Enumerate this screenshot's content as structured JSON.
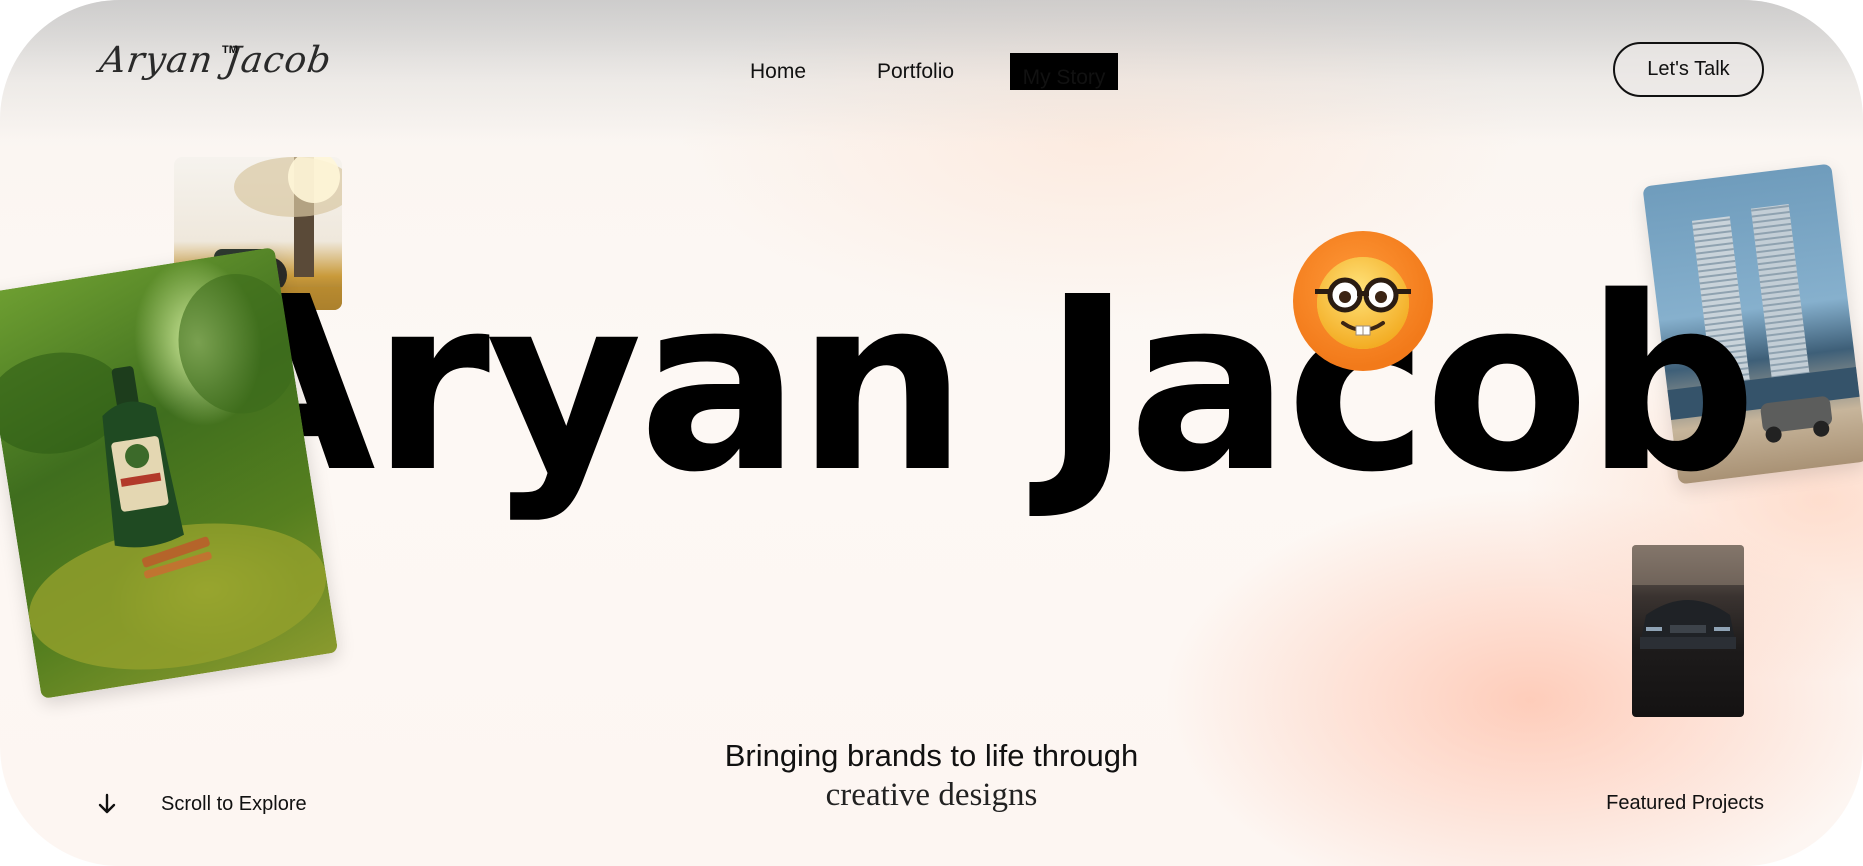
{
  "brand": {
    "logo_text": "Aryan Jacob",
    "trademark": "TM"
  },
  "nav": {
    "items": [
      {
        "label": "Home",
        "active": false
      },
      {
        "label": "Portfolio",
        "active": false
      },
      {
        "label": "My Story",
        "active": true
      }
    ],
    "cta_label": "Let's Talk"
  },
  "hero": {
    "title": "Aryan Jacob",
    "emoji_icon": "nerd-face-emoji"
  },
  "photos": [
    {
      "name": "motorcycle-photo"
    },
    {
      "name": "liquor-bottle-photo"
    },
    {
      "name": "towers-car-photo"
    },
    {
      "name": "black-car-photo"
    }
  ],
  "tagline": {
    "line1": "Bringing brands to life through",
    "line2": "creative designs"
  },
  "footer": {
    "scroll_label": "Scroll to Explore",
    "scroll_icon": "arrow-down-icon",
    "featured_label": "Featured Projects"
  },
  "colors": {
    "accent_emoji_bg": "#f27a1a",
    "active_nav_bg": "#000000",
    "text": "#111111"
  }
}
